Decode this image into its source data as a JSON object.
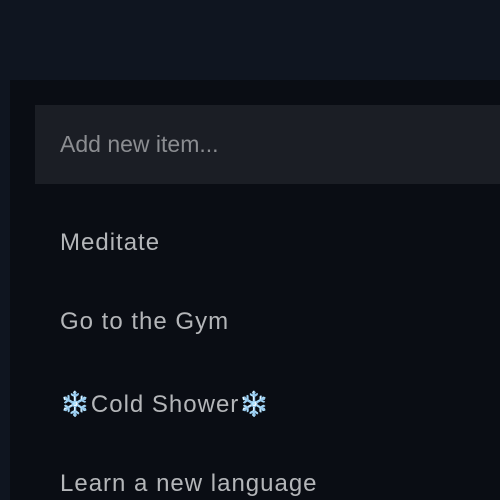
{
  "todo": {
    "input": {
      "placeholder": "Add new item...",
      "value": ""
    },
    "items": [
      {
        "text": "Meditate"
      },
      {
        "text": "Go to the Gym"
      },
      {
        "text": "Cold Shower",
        "prefix": "❄️",
        "suffix": "❄️"
      },
      {
        "text": "Learn a new language"
      }
    ]
  },
  "colors": {
    "page_background": "#0f1520",
    "panel_background": "#0a0d14",
    "input_background": "#1b1e25",
    "item_text": "#b4b6b9",
    "placeholder_text": "#8b8d91",
    "snowflake": "#6fcff5"
  }
}
